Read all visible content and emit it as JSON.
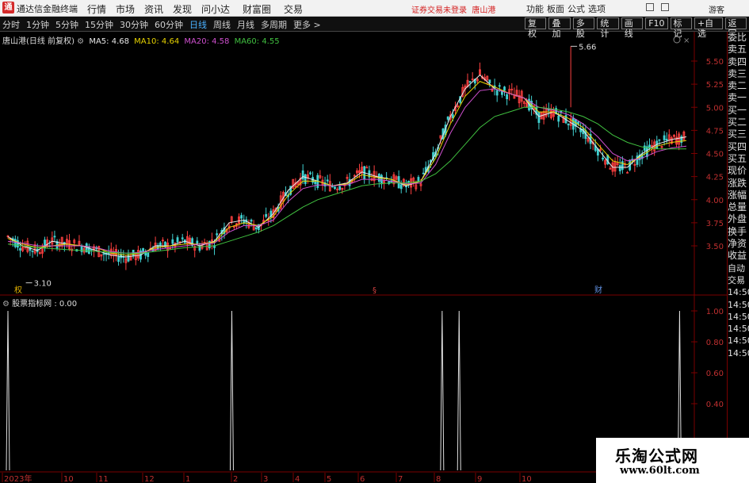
{
  "app": {
    "logo": "通",
    "title": "通达信金融终端"
  },
  "menu": [
    "行情",
    "市场",
    "资讯",
    "发现",
    "问小达",
    "财富圈",
    "交易"
  ],
  "trade_status": "证券交易未登录",
  "stock_name_top": "唐山港",
  "right_menu": [
    "功能",
    "板面",
    "公式",
    "选项"
  ],
  "guest": "游客",
  "periods": [
    "分时",
    "1分钟",
    "5分钟",
    "15分钟",
    "30分钟",
    "60分钟",
    "日线",
    "周线",
    "月线",
    "多周期",
    "更多 >"
  ],
  "active_period": "日线",
  "tools": [
    "复权",
    "叠加",
    "多股",
    "统计",
    "画线",
    "F10",
    "标记",
    "+自选",
    "返回"
  ],
  "main_header": {
    "symbol": "唐山港(日线 前复权)",
    "ma": [
      {
        "label": "MA5: 4.68",
        "color": "#e8e8e8"
      },
      {
        "label": "MA10: 4.64",
        "color": "#e8d400"
      },
      {
        "label": "MA20: 4.58",
        "color": "#d050d0"
      },
      {
        "label": "MA60: 4.55",
        "color": "#40c040"
      }
    ]
  },
  "price_axis": [
    "5.50",
    "5.25",
    "5.00",
    "4.75",
    "4.50",
    "4.25",
    "4.00",
    "3.75",
    "3.50"
  ],
  "annotations": {
    "high": "5.66",
    "low": "3.10"
  },
  "markers": [
    "权",
    "§",
    "财"
  ],
  "sub_header": "股票指标网 : 0.00",
  "sub_axis": [
    "1.00",
    "0.80",
    "0.60",
    "0.40"
  ],
  "date_axis": [
    "2023年",
    "10",
    "11",
    "12",
    "1",
    "2",
    "3",
    "4",
    "5",
    "6",
    "7",
    "8",
    "9",
    "10"
  ],
  "right_panel": [
    "委比",
    "卖五",
    "卖四",
    "卖三",
    "卖二",
    "卖一",
    "买一",
    "买二",
    "买三",
    "买四",
    "买五",
    "现价",
    "涨跌",
    "涨幅",
    "总量",
    "外盘",
    "换手",
    "净资",
    "收益",
    "",
    "自动",
    "交易",
    "14:50",
    "14:50",
    "14:50",
    "14:50",
    "14:50",
    "14:50"
  ],
  "watermark": {
    "title": "乐淘公式网",
    "url": "www.60lt.com"
  },
  "chart_data": {
    "type": "line",
    "price_range": [
      3.1,
      5.66
    ],
    "series": [
      {
        "name": "MA5",
        "color": "#e8e8e8",
        "values": [
          3.6,
          3.5,
          3.45,
          3.55,
          3.52,
          3.5,
          3.45,
          3.4,
          3.38,
          3.4,
          3.5,
          3.5,
          3.55,
          3.5,
          3.55,
          3.75,
          3.78,
          3.7,
          3.85,
          4.1,
          4.25,
          4.2,
          4.15,
          4.18,
          4.3,
          4.25,
          4.22,
          4.15,
          4.2,
          4.5,
          4.9,
          5.2,
          5.35,
          5.2,
          5.15,
          5.1,
          4.9,
          4.95,
          4.85,
          4.75,
          4.55,
          4.35,
          4.35,
          4.5,
          4.6,
          4.65,
          4.68
        ]
      },
      {
        "name": "MA10",
        "color": "#e8d400",
        "values": [
          3.58,
          3.52,
          3.48,
          3.5,
          3.52,
          3.5,
          3.48,
          3.42,
          3.4,
          3.42,
          3.48,
          3.5,
          3.52,
          3.52,
          3.54,
          3.7,
          3.75,
          3.72,
          3.82,
          4.05,
          4.2,
          4.2,
          4.15,
          4.17,
          4.27,
          4.24,
          4.22,
          4.16,
          4.2,
          4.45,
          4.82,
          5.12,
          5.28,
          5.22,
          5.15,
          5.1,
          4.95,
          4.95,
          4.88,
          4.78,
          4.6,
          4.42,
          4.38,
          4.48,
          4.58,
          4.62,
          4.64
        ]
      },
      {
        "name": "MA20",
        "color": "#d050d0",
        "values": [
          3.55,
          3.53,
          3.5,
          3.5,
          3.5,
          3.5,
          3.48,
          3.44,
          3.42,
          3.43,
          3.46,
          3.48,
          3.5,
          3.52,
          3.53,
          3.65,
          3.72,
          3.72,
          3.78,
          3.98,
          4.12,
          4.16,
          4.15,
          4.16,
          4.22,
          4.22,
          4.2,
          4.17,
          4.18,
          4.38,
          4.72,
          5.0,
          5.18,
          5.2,
          5.15,
          5.1,
          5.0,
          4.97,
          4.92,
          4.82,
          4.68,
          4.5,
          4.42,
          4.45,
          4.52,
          4.56,
          4.58
        ]
      },
      {
        "name": "MA60",
        "color": "#40c040",
        "values": [
          3.52,
          3.5,
          3.48,
          3.47,
          3.46,
          3.45,
          3.44,
          3.43,
          3.42,
          3.42,
          3.44,
          3.46,
          3.48,
          3.49,
          3.5,
          3.55,
          3.6,
          3.65,
          3.72,
          3.82,
          3.92,
          4.0,
          4.05,
          4.1,
          4.15,
          4.17,
          4.18,
          4.18,
          4.2,
          4.28,
          4.42,
          4.6,
          4.78,
          4.9,
          4.95,
          5.0,
          5.0,
          4.98,
          4.95,
          4.9,
          4.82,
          4.7,
          4.62,
          4.57,
          4.55,
          4.55,
          4.55
        ]
      }
    ],
    "indicator": {
      "name": "股票指标网",
      "spikes_at": [
        0.0,
        0.33,
        0.64,
        0.665,
        0.99
      ],
      "ylim": [
        0,
        1
      ]
    }
  }
}
